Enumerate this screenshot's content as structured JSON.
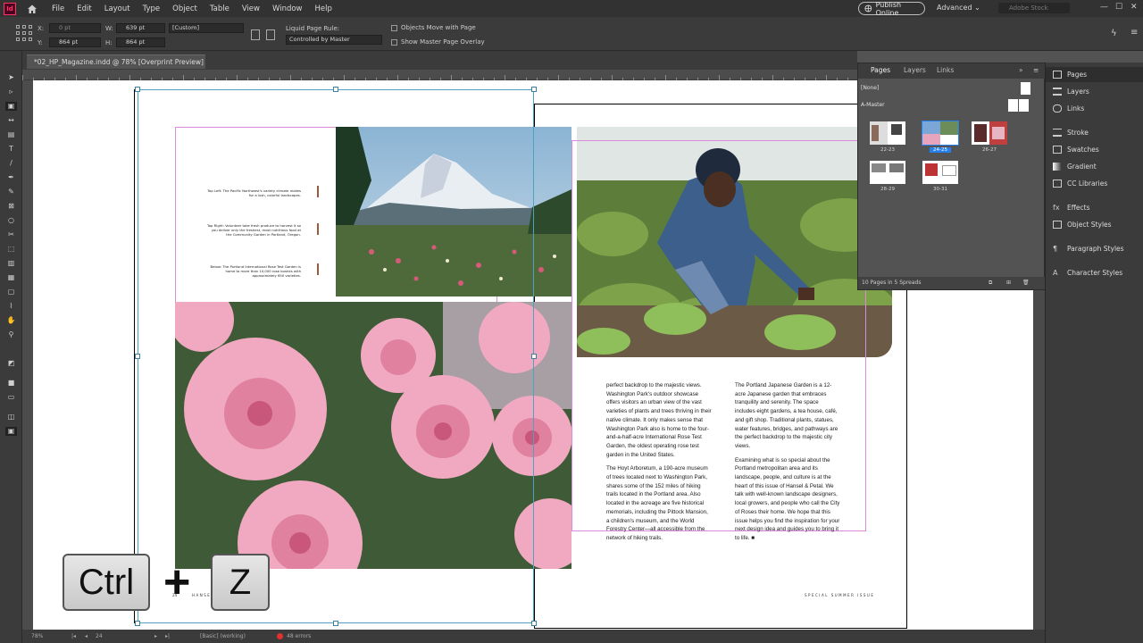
{
  "menubar": {
    "logo": "Id",
    "items": [
      "File",
      "Edit",
      "Layout",
      "Type",
      "Object",
      "Table",
      "View",
      "Window",
      "Help"
    ],
    "publish_label": "Publish Online",
    "workspace": "Advanced",
    "search_placeholder": "Adobe Stock"
  },
  "control": {
    "x_label": "X:",
    "x_value": "0 pt",
    "y_label": "Y:",
    "y_value": "864 pt",
    "w_label": "W:",
    "w_value": "639 pt",
    "h_label": "H:",
    "h_value": "864 pt",
    "scale_value": "[Custom]",
    "liquid_label": "Liquid Page Rule:",
    "liquid_value": "Controlled by Master",
    "objects_move": "Objects Move with Page",
    "show_master": "Show Master Page Overlay"
  },
  "document": {
    "tab_title": "*02_HP_Magazine.indd @ 78% [Overprint Preview]",
    "close": "×"
  },
  "spread": {
    "captions": [
      "Top Left: The Pacific Northwest's variety climate makes for a lush, colorful landscapes.",
      "Top Right: Volunteer take fresh produce to harvest it so you deliver only the freshest, most nutritious food at the Community Garden in Portland, Oregon.",
      "Below: The Portland International Rose Test Garden is home to more than 10,000 rose bushes with approximately 650 varieties."
    ],
    "col1": [
      "perfect backdrop to the majestic views. Washington Park's outdoor showcase offers visitors an urban view of the vast varieties of plants and trees thriving in their native climate. It only makes sense that Washington Park also is home to the four-and-a-half-acre International Rose Test Garden, the oldest operating rose test garden in the United States.",
      "The Hoyt Arboretum, a 190-acre museum of trees located next to Washington Park, shares some of the 152 miles of hiking trails located in the Portland area. Also located in the acreage are five historical memorials, including the Pittock Mansion, a children's museum, and the World Forestry Center—all accessible from the network of hiking trails."
    ],
    "col2": [
      "The Portland Japanese Garden is a 12-acre Japanese garden that embraces tranquility and serenity. The space includes eight gardens, a tea house, café, and gift shop. Traditional plants, statues, water features, bridges, and pathways are the perfect backdrop to the majestic city views.",
      "Examining what is so special about the Portland metropolitan area and its landscape, people, and culture is at the heart of this issue of Hansel & Petal. We talk with well-known landscape designers, local growers, and people who call the City of Roses their home. We hope that this issue helps you find the inspiration for your next design idea and guides you to bring it to life. ■"
    ],
    "folio_left_num": "24",
    "folio_left": "HANSEL & PETAL",
    "folio_right": "SPECIAL SUMMER ISSUE"
  },
  "keys": {
    "ctrl": "Ctrl",
    "plus": "+",
    "z": "Z"
  },
  "pages_panel": {
    "tabs": [
      "Pages",
      "Layers",
      "Links"
    ],
    "none_label": "[None]",
    "master_label": "A-Master",
    "spreads": [
      "22-23",
      "24-25",
      "26-27",
      "28-29",
      "30-31"
    ],
    "selected_spread": "24-25",
    "footer": "10 Pages in 5 Spreads"
  },
  "dock": {
    "items": [
      "Pages",
      "Layers",
      "Links",
      "Stroke",
      "Swatches",
      "Gradient",
      "CC Libraries",
      "Effects",
      "Object Styles",
      "Paragraph Styles",
      "Character Styles"
    ]
  },
  "status": {
    "zoom": "78%",
    "page": "24",
    "style": "[Basic] (working)",
    "errors": "48 errors"
  },
  "colors": {
    "accent": "#2680eb",
    "margin": "#d98ad9",
    "frame": "#50a0c0",
    "caption_rule": "#9c5a3c"
  }
}
